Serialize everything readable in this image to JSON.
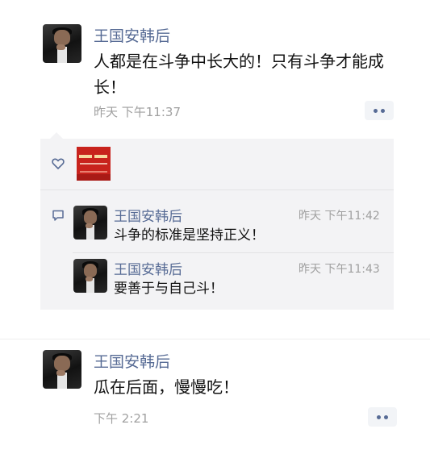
{
  "post": {
    "author": "王国安韩后",
    "text": "人都是在斗争中长大的！只有斗争才能成长！",
    "time": "昨天 下午11:37"
  },
  "likes": {
    "icon": "heart-icon"
  },
  "comments": [
    {
      "author": "王国安韩后",
      "text": "斗争的标准是坚持正义！",
      "time": "昨天 下午11:42"
    },
    {
      "author": "王国安韩后",
      "text": "要善于与自己斗！",
      "time": "昨天 下午11:43"
    }
  ],
  "post2": {
    "author": "王国安韩后",
    "text": "瓜在后面，慢慢吃！",
    "time": "下午 2:21"
  },
  "colors": {
    "name": "#576b95",
    "time": "#a0a0a0",
    "panel": "#f3f3f5"
  }
}
